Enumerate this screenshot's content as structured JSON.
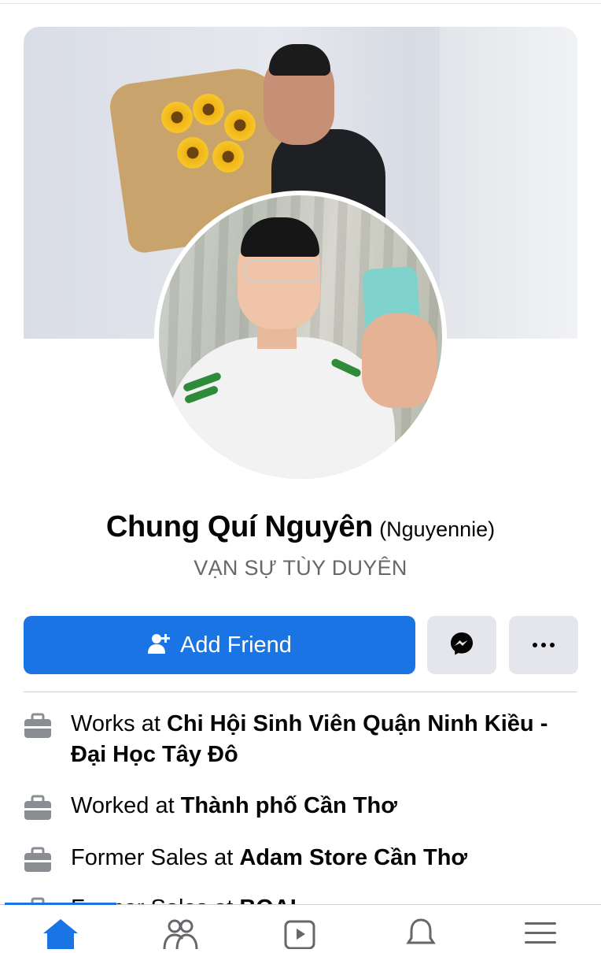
{
  "profile": {
    "name": "Chung Quí Nguyên",
    "alternate_name": "(Nguyennie)",
    "bio": "VẠN SỰ TÙY DUYÊN"
  },
  "actions": {
    "add_friend_label": "Add Friend",
    "message_icon": "messenger-icon",
    "more_icon": "more-options-icon"
  },
  "intro": {
    "items": [
      {
        "prefix": "Works at ",
        "value": "Chi Hội Sinh Viên Quận Ninh Kiều - Đại Học Tây Đô",
        "icon": "briefcase-icon"
      },
      {
        "prefix": "Worked at ",
        "value": "Thành phố Cần Thơ",
        "icon": "briefcase-icon"
      },
      {
        "prefix": "Former Sales at ",
        "value": "Adam Store Cần Thơ",
        "icon": "briefcase-icon"
      },
      {
        "prefix": "Former Sales at ",
        "value": "BOAI",
        "icon": "briefcase-icon"
      }
    ]
  },
  "bottom_nav": {
    "items": [
      {
        "name": "home",
        "icon": "home-icon",
        "active": true
      },
      {
        "name": "friends",
        "icon": "friends-icon",
        "active": false
      },
      {
        "name": "watch",
        "icon": "video-icon",
        "active": false
      },
      {
        "name": "notifications",
        "icon": "bell-icon",
        "active": false
      },
      {
        "name": "menu",
        "icon": "menu-icon",
        "active": false
      }
    ]
  },
  "colors": {
    "primary_blue": "#1b74e4",
    "secondary_button": "#e4e6eb",
    "muted_text": "#65676b",
    "icon_gray": "#8a8d91"
  }
}
